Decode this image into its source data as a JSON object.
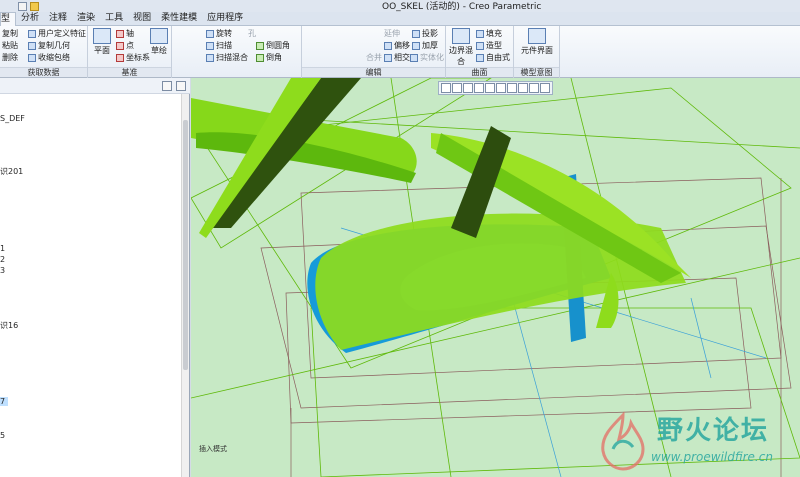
{
  "window": {
    "title": "OO_SKEL (活动的) - Creo Parametric"
  },
  "tabs": [
    {
      "label": "型",
      "active": true
    },
    {
      "label": "分析",
      "active": false
    },
    {
      "label": "注释",
      "active": false
    },
    {
      "label": "渲染",
      "active": false
    },
    {
      "label": "工具",
      "active": false
    },
    {
      "label": "视图",
      "active": false
    },
    {
      "label": "柔性建模",
      "active": false
    },
    {
      "label": "应用程序",
      "active": false
    }
  ],
  "ribbon": {
    "get_data": {
      "items": [
        "复制",
        "粘贴",
        "删除"
      ],
      "items2": [
        "用户定义特征",
        "复制几何",
        "收缩包络"
      ],
      "label": "获取数据"
    },
    "datum": {
      "plane": "平面",
      "axis": "轴",
      "point": "点",
      "csys": "坐标系",
      "sketch": "草绘",
      "label": "基准"
    },
    "shapes": {
      "revolve": "旋转",
      "sweep": "扫描",
      "swept_blend": "扫描混合",
      "hole": "孔",
      "round": "倒圆角",
      "chamfer": "倒角"
    },
    "editing": {
      "extend": "延伸",
      "project": "投影",
      "offset": "偏移",
      "thicken": "加厚",
      "intersect": "相交",
      "solidify": "实体化",
      "merge": "合并",
      "label": "编辑"
    },
    "surfaces": {
      "boundary_blend": "边界混合",
      "fill": "填充",
      "style": "造型",
      "freestyle": "自由式",
      "label": "曲面"
    },
    "model_intent": {
      "component_interface": "元件界面",
      "label": "模型意图"
    }
  },
  "tree": {
    "rows": [
      {
        "text": "S_DEF"
      },
      {
        "text": "识201"
      },
      {
        "text": "1"
      },
      {
        "text": "2"
      },
      {
        "text": "3"
      },
      {
        "text": "识16"
      },
      {
        "text": "7",
        "selected": true
      },
      {
        "text": "5"
      }
    ]
  },
  "viewport": {
    "mode_text": "插入模式"
  },
  "watermark": {
    "title": "野火论坛",
    "url": "www.proewildfire.cn"
  },
  "colors": {
    "viewport_bg": "#c7e9c5",
    "surface_green": "#8ee01e",
    "surface_dark": "#2d4d0e",
    "solid_blue": "#1ea0e0",
    "ribbon_bg": "#eef2f8"
  }
}
